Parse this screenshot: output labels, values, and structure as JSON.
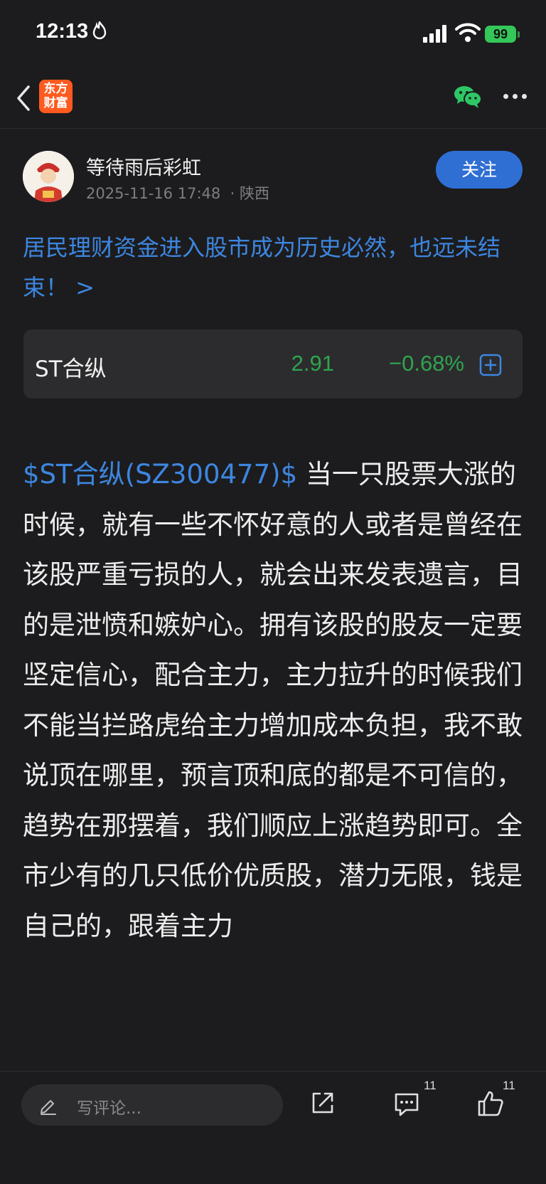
{
  "status_bar": {
    "time": "12:13",
    "battery": "99"
  },
  "nav": {
    "logo_text": "东方财富",
    "icons": [
      "back-icon",
      "wechat-icon",
      "more-icon"
    ]
  },
  "author": {
    "name": "等待雨后彩虹",
    "datetime": "2025-11-16 17:48",
    "location": "· 陕西",
    "follow_label": "关注"
  },
  "post": {
    "title": "居民理财资金进入股市成为历史必然，也远未结束！ >",
    "stock_link": "$ST合纵(SZ300477)$",
    "body": "  当一只股票大涨的时候，就有一些不怀好意的人或者是曾经在该股严重亏损的人，就会出来发表遗言，目的是泄愤和嫉妒心。拥有该股的股友一定要坚定信心，配合主力，主力拉升的时候我们不能当拦路虎给主力增加成本负担，我不敢说顶在哪里，预言顶和底的都是不可信的，趋势在那摆着，我们顺应上涨趋势即可。全市少有的几只低价优质股，潜力无限，钱是自己的，跟着主力"
  },
  "stock_card": {
    "name": "ST合纵",
    "price": "2.91",
    "change": "−0.68%",
    "color": "#2ea44f"
  },
  "bottom_bar": {
    "comment_placeholder": "写评论...",
    "comment_count": "11",
    "like_count": "11"
  },
  "colors": {
    "background": "#1c1c1e",
    "accent": "#3d86e0",
    "follow_button": "#2f6fd4",
    "logo": "#ff5a1f"
  }
}
